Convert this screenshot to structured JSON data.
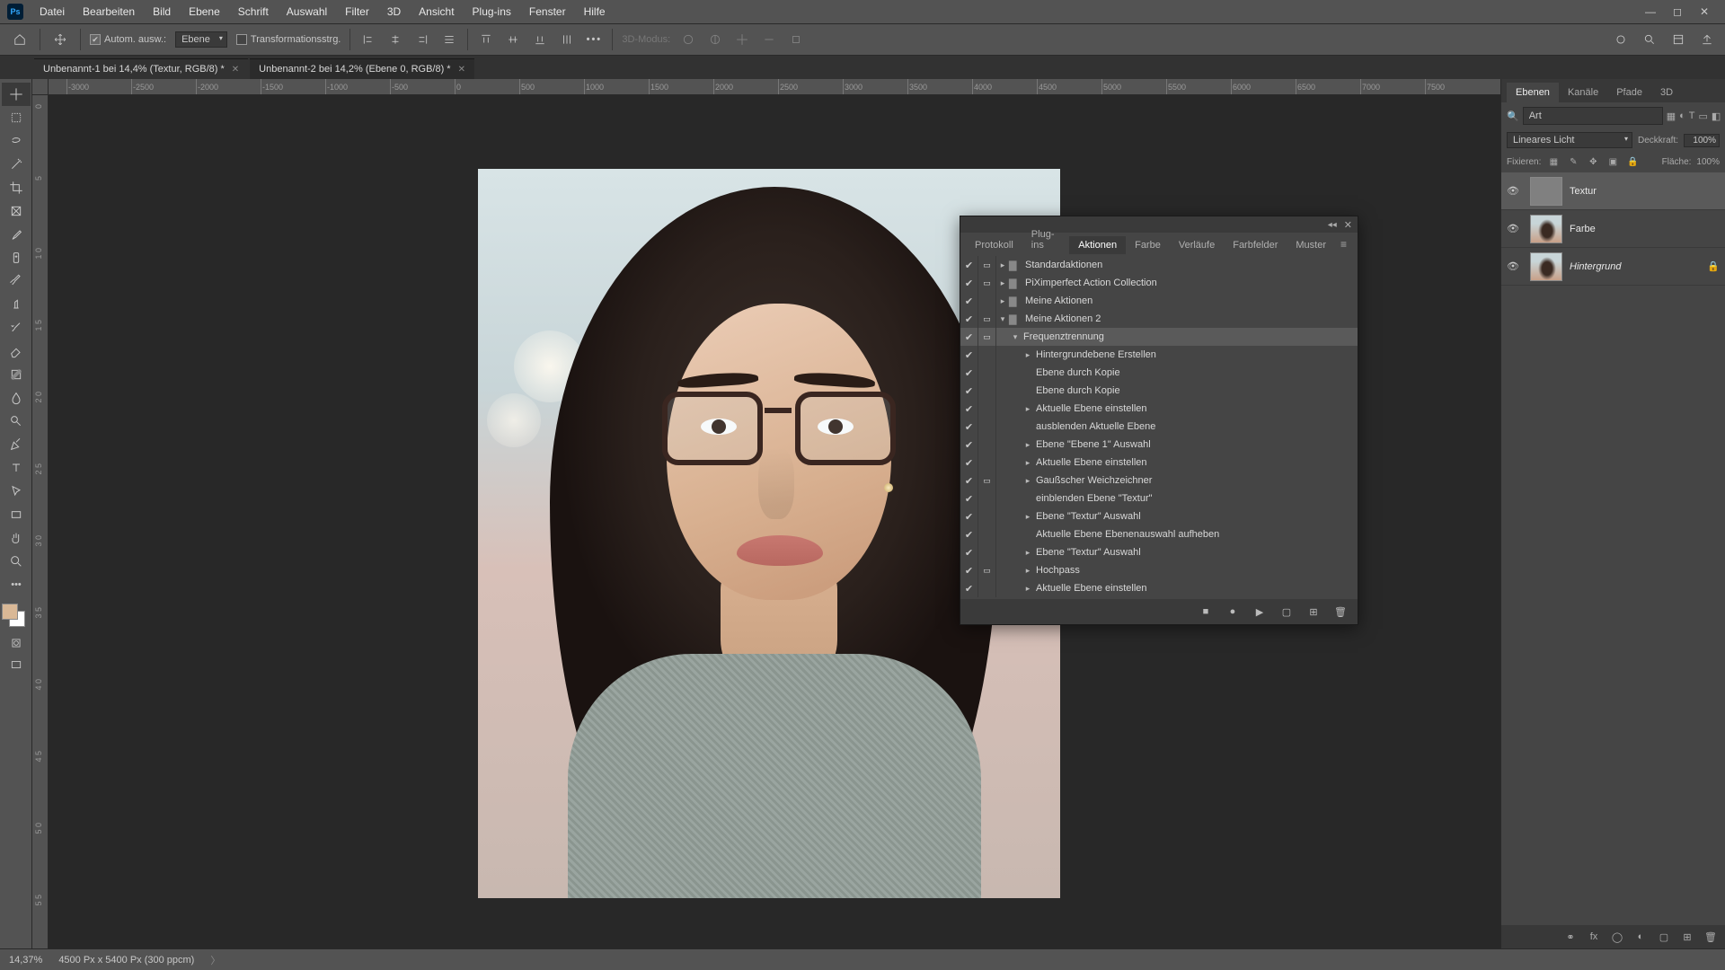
{
  "menubar": {
    "items": [
      "Datei",
      "Bearbeiten",
      "Bild",
      "Ebene",
      "Schrift",
      "Auswahl",
      "Filter",
      "3D",
      "Ansicht",
      "Plug-ins",
      "Fenster",
      "Hilfe"
    ]
  },
  "optionsbar": {
    "auto_select_label": "Autom. ausw.:",
    "auto_select_target": "Ebene",
    "transform_label": "Transformationsstrg.",
    "mode3d_label": "3D-Modus:"
  },
  "doctabs": [
    {
      "title": "Unbenannt-1 bei 14,4% (Textur, RGB/8) *",
      "active": true
    },
    {
      "title": "Unbenannt-2 bei 14,2% (Ebene 0, RGB/8) *",
      "active": false
    }
  ],
  "ruler_h": [
    "-3000",
    "-2500",
    "-2000",
    "-1500",
    "-1000",
    "-500",
    "0",
    "500",
    "1000",
    "1500",
    "2000",
    "2500",
    "3000",
    "3500",
    "4000",
    "4500",
    "5000",
    "5500",
    "6000",
    "6500",
    "7000",
    "7500"
  ],
  "ruler_v": [
    "0",
    "5",
    "1 0",
    "1 5",
    "2 0",
    "2 5",
    "3 0",
    "3 5",
    "4 0",
    "4 5",
    "5 0",
    "5 5"
  ],
  "swatches": {
    "fg": "#d9b896",
    "bg": "#ffffff"
  },
  "actions_panel": {
    "tabs": [
      "Protokoll",
      "Plug-ins",
      "Aktionen",
      "Farbe",
      "Verläufe",
      "Farbfelder",
      "Muster"
    ],
    "active_tab_index": 2,
    "rows": [
      {
        "checked": true,
        "dialog": true,
        "indent": 0,
        "expand": "▸",
        "folder": true,
        "label": "Standardaktionen",
        "selected": false
      },
      {
        "checked": true,
        "dialog": true,
        "indent": 0,
        "expand": "▸",
        "folder": true,
        "label": "PiXimperfect Action Collection",
        "selected": false
      },
      {
        "checked": true,
        "dialog": false,
        "indent": 0,
        "expand": "▸",
        "folder": true,
        "label": "Meine Aktionen",
        "selected": false
      },
      {
        "checked": true,
        "dialog": true,
        "indent": 0,
        "expand": "▾",
        "folder": true,
        "label": "Meine Aktionen 2",
        "selected": false
      },
      {
        "checked": true,
        "dialog": true,
        "indent": 1,
        "expand": "▾",
        "folder": false,
        "label": "Frequenztrennung",
        "selected": true
      },
      {
        "checked": true,
        "dialog": false,
        "indent": 2,
        "expand": "▸",
        "folder": false,
        "label": "Hintergrundebene Erstellen",
        "selected": false
      },
      {
        "checked": true,
        "dialog": false,
        "indent": 2,
        "expand": "",
        "folder": false,
        "label": "Ebene durch Kopie",
        "selected": false
      },
      {
        "checked": true,
        "dialog": false,
        "indent": 2,
        "expand": "",
        "folder": false,
        "label": "Ebene durch Kopie",
        "selected": false
      },
      {
        "checked": true,
        "dialog": false,
        "indent": 2,
        "expand": "▸",
        "folder": false,
        "label": "Aktuelle Ebene einstellen",
        "selected": false
      },
      {
        "checked": true,
        "dialog": false,
        "indent": 2,
        "expand": "",
        "folder": false,
        "label": "ausblenden Aktuelle Ebene",
        "selected": false
      },
      {
        "checked": true,
        "dialog": false,
        "indent": 2,
        "expand": "▸",
        "folder": false,
        "label": "Ebene \"Ebene 1\" Auswahl",
        "selected": false
      },
      {
        "checked": true,
        "dialog": false,
        "indent": 2,
        "expand": "▸",
        "folder": false,
        "label": "Aktuelle Ebene einstellen",
        "selected": false
      },
      {
        "checked": true,
        "dialog": true,
        "indent": 2,
        "expand": "▸",
        "folder": false,
        "label": "Gaußscher Weichzeichner",
        "selected": false
      },
      {
        "checked": true,
        "dialog": false,
        "indent": 2,
        "expand": "",
        "folder": false,
        "label": "einblenden Ebene \"Textur\"",
        "selected": false
      },
      {
        "checked": true,
        "dialog": false,
        "indent": 2,
        "expand": "▸",
        "folder": false,
        "label": "Ebene \"Textur\" Auswahl",
        "selected": false
      },
      {
        "checked": true,
        "dialog": false,
        "indent": 2,
        "expand": "",
        "folder": false,
        "label": "Aktuelle Ebene Ebenenauswahl aufheben",
        "selected": false
      },
      {
        "checked": true,
        "dialog": false,
        "indent": 2,
        "expand": "▸",
        "folder": false,
        "label": "Ebene \"Textur\" Auswahl",
        "selected": false
      },
      {
        "checked": true,
        "dialog": true,
        "indent": 2,
        "expand": "▸",
        "folder": false,
        "label": "Hochpass",
        "selected": false
      },
      {
        "checked": true,
        "dialog": false,
        "indent": 2,
        "expand": "▸",
        "folder": false,
        "label": "Aktuelle Ebene einstellen",
        "selected": false
      }
    ]
  },
  "layers_panel": {
    "tabs": [
      "Ebenen",
      "Kanäle",
      "Pfade",
      "3D"
    ],
    "search_placeholder": "Art",
    "blend_mode": "Lineares Licht",
    "opacity_label": "Deckkraft:",
    "opacity_value": "100%",
    "lock_label": "Fixieren:",
    "fill_label": "Fläche:",
    "fill_value": "100%",
    "layers": [
      {
        "visible": true,
        "thumb": "grey",
        "name": "Textur",
        "locked": false,
        "selected": true
      },
      {
        "visible": true,
        "thumb": "p1",
        "name": "Farbe",
        "locked": false,
        "selected": false
      },
      {
        "visible": true,
        "thumb": "p1",
        "name": "Hintergrund",
        "locked": true,
        "selected": false
      }
    ]
  },
  "statusbar": {
    "zoom": "14,37%",
    "doc_info": "4500 Px x 5400 Px (300 ppcm)"
  }
}
